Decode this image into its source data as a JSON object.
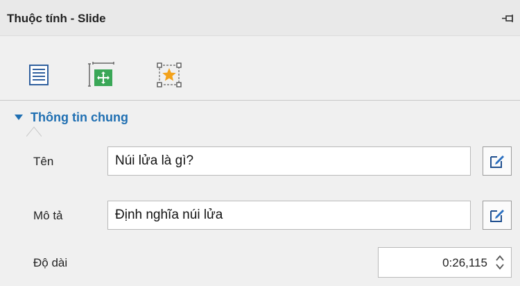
{
  "panel": {
    "title": "Thuộc tính - Slide"
  },
  "tabs": [
    {
      "name": "properties",
      "icon": "list-icon",
      "selected": true
    },
    {
      "name": "layout",
      "icon": "move-icon",
      "selected": false
    },
    {
      "name": "effects",
      "icon": "star-icon",
      "selected": false
    }
  ],
  "section": {
    "title": "Thông tin chung",
    "expanded": true
  },
  "fields": {
    "name_label": "Tên",
    "name_value": "Núi lửa là gì?",
    "description_label": "Mô tả",
    "description_value": "Định nghĩa núi lửa",
    "duration_label": "Độ dài",
    "duration_value": "0:26,115"
  },
  "colors": {
    "accent": "#1f6fb2",
    "tab_green": "#3aa757",
    "star": "#f3a21b"
  }
}
